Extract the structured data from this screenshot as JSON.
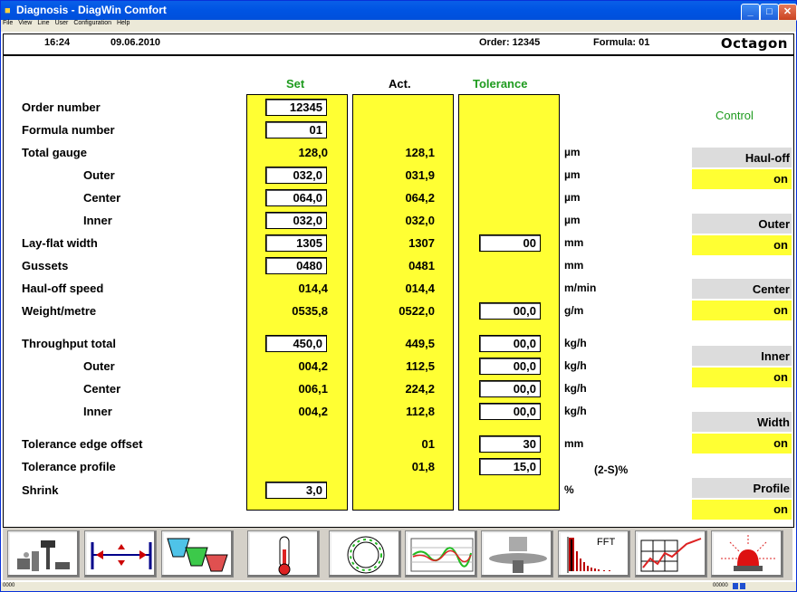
{
  "window": {
    "title": "Diagnosis - DiagWin Comfort"
  },
  "menu": [
    "File",
    "View",
    "Line",
    "User",
    "Configuration",
    "Help"
  ],
  "header": {
    "time": "16:24",
    "date": "09.06.2010",
    "order": "Order: 12345",
    "formula": "Formula: 01",
    "logo": "Octagon"
  },
  "columns": {
    "set": "Set",
    "act": "Act.",
    "tolerance": "Tolerance"
  },
  "colors": {
    "set_header": "#1e9b1e",
    "tolerance_header": "#1e9b1e",
    "control": "#1e9b1e",
    "yellow": "#ffff33"
  },
  "rows": [
    {
      "label": "Order number",
      "set": "12345",
      "act": "",
      "tol": "",
      "unit": ""
    },
    {
      "label": "Formula number",
      "set": "01",
      "act": "",
      "tol": "",
      "unit": ""
    },
    {
      "label": "Total gauge",
      "set": "128,0",
      "act": "128,1",
      "tol": "",
      "unit": "µm"
    },
    {
      "label": "Outer",
      "set": "032,0",
      "act": "031,9",
      "tol": "",
      "unit": "µm"
    },
    {
      "label": "Center",
      "set": "064,0",
      "act": "064,2",
      "tol": "",
      "unit": "µm"
    },
    {
      "label": "Inner",
      "set": "032,0",
      "act": "032,0",
      "tol": "",
      "unit": "µm"
    },
    {
      "label": "Lay-flat width",
      "set": "1305",
      "act": "1307",
      "tol": "00",
      "unit": "mm"
    },
    {
      "label": "Gussets",
      "set": "0480",
      "act": "0481",
      "tol": "",
      "unit": "mm"
    },
    {
      "label": "Haul-off speed",
      "set": "014,4",
      "act": "014,4",
      "tol": "",
      "unit": "m/min"
    },
    {
      "label": "Weight/metre",
      "set": "0535,8",
      "act": "0522,0",
      "tol": "00,0",
      "unit": "g/m"
    },
    {
      "label": "Throughput total",
      "set": "450,0",
      "act": "449,5",
      "tol": "00,0",
      "unit": "kg/h"
    },
    {
      "label": "Outer",
      "set": "004,2",
      "act": "112,5",
      "tol": "00,0",
      "unit": "kg/h"
    },
    {
      "label": "Center",
      "set": "006,1",
      "act": "224,2",
      "tol": "00,0",
      "unit": "kg/h"
    },
    {
      "label": "Inner",
      "set": "004,2",
      "act": "112,8",
      "tol": "00,0",
      "unit": "kg/h"
    },
    {
      "label": "Tolerance edge offset",
      "set": "",
      "act": "01",
      "tol": "30",
      "unit": "mm"
    },
    {
      "label": "Tolerance profile",
      "set": "",
      "act": "01,8",
      "tol": "15,0",
      "unit": "(2-S)%"
    },
    {
      "label": "Shrink",
      "set": "3,0",
      "act": "",
      "tol": "",
      "unit": "%"
    }
  ],
  "control": {
    "title": "Control",
    "items": [
      {
        "label": "Haul-off",
        "state": "on"
      },
      {
        "label": "Outer",
        "state": "on"
      },
      {
        "label": "Center",
        "state": "on"
      },
      {
        "label": "Inner",
        "state": "on"
      },
      {
        "label": "Width",
        "state": "on"
      },
      {
        "label": "Profile",
        "state": "on"
      }
    ]
  },
  "toolbar": {
    "fft_label": "FFT"
  },
  "status": {
    "left": "0000",
    "right": "00000"
  }
}
